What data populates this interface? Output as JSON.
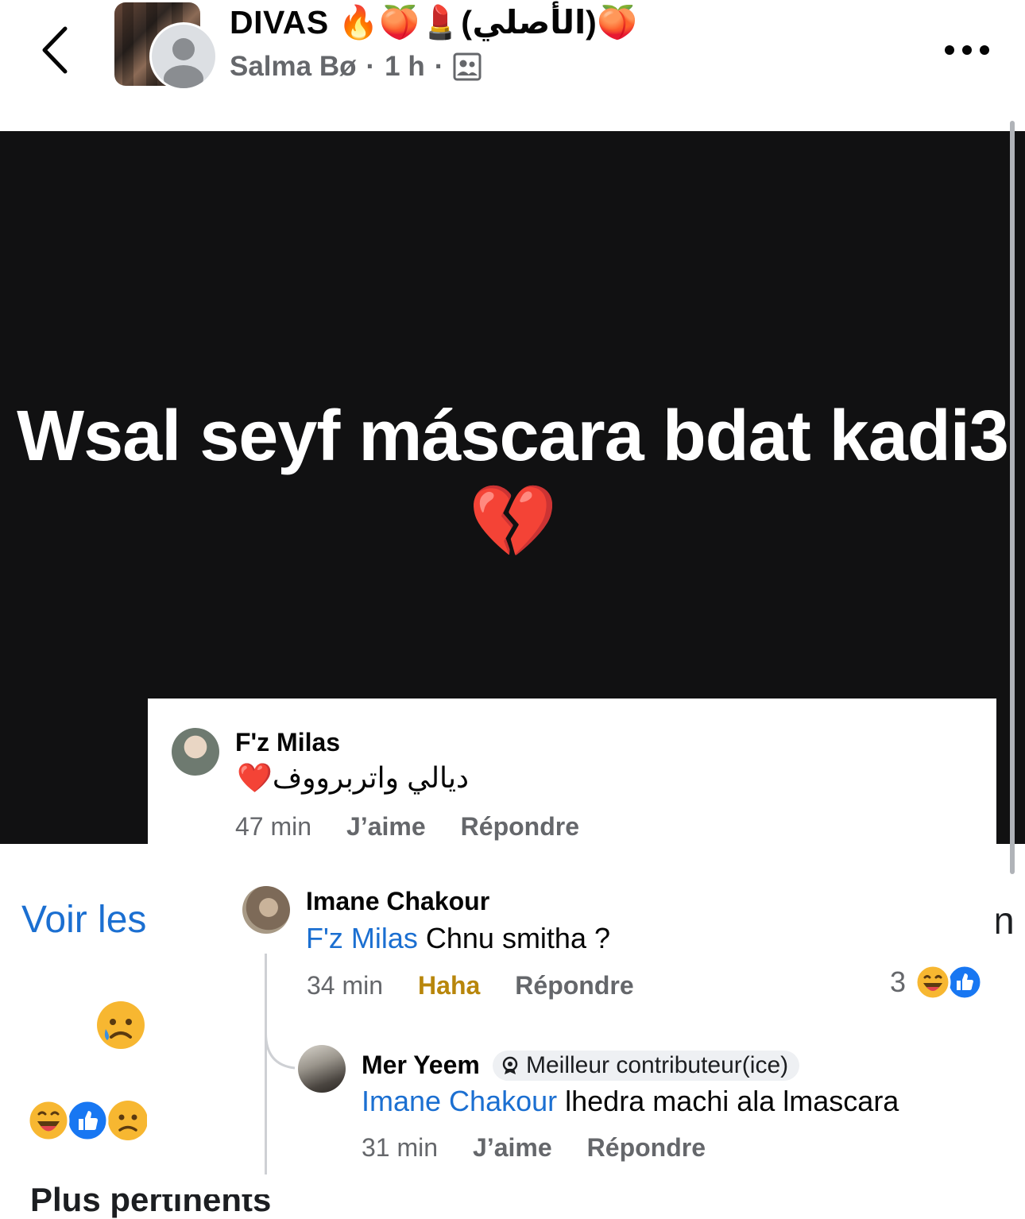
{
  "header": {
    "group_name": "DIVAS 🔥🍑💄(الأصلي)🍑",
    "author": "Salma Bø",
    "time": "1 h",
    "separator": "·"
  },
  "post": {
    "text": "Wsal seyf máscara bdat kadi3 💔"
  },
  "background": {
    "voir_les": "Voir les",
    "right_glyph": "n",
    "bottom_text": "Plus pertinents"
  },
  "comments": [
    {
      "author": "F'z Milas",
      "text": "ديالي واتربرووف❤️",
      "time": "47 min",
      "like": "J’aime",
      "reply": "Répondre"
    },
    {
      "author": "Imane Chakour",
      "mention": "F'z Milas",
      "text": " Chnu smitha ?",
      "time": "34 min",
      "like": "Haha",
      "reply": "Répondre",
      "reaction_count": "3"
    },
    {
      "author": "Mer Yeem",
      "badge": "Meilleur contributeur(ice)",
      "mention": "Imane Chakour",
      "text": " lhedra machi ala lmascara",
      "time": "31 min",
      "like": "J’aime",
      "reply": "Répondre"
    }
  ],
  "colors": {
    "mention": "#1b6fd1",
    "haha": "#b8860b",
    "post_bg": "#111112",
    "secondary_text": "#65676b"
  },
  "icons": [
    "back-chevron-icon",
    "more-options-icon",
    "members-icon",
    "haha-reaction-icon",
    "like-reaction-icon",
    "sad-reaction-icon",
    "top-contributor-badge-icon"
  ]
}
